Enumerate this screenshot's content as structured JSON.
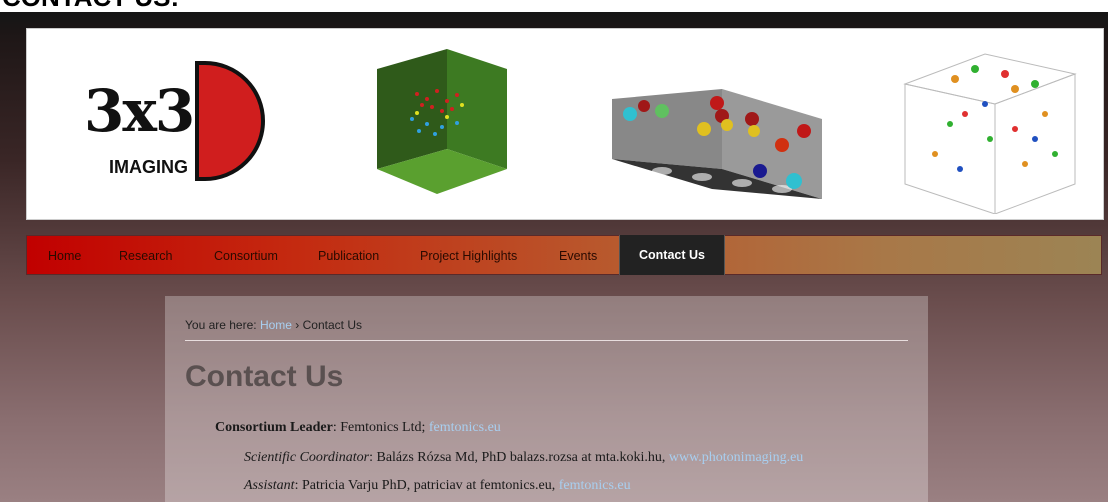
{
  "page": {
    "heading": "CONTACT US:"
  },
  "banner": {
    "logo_text": "3x3",
    "logo_subtext": "IMAGING"
  },
  "nav": {
    "items": [
      {
        "label": "Home"
      },
      {
        "label": "Research"
      },
      {
        "label": "Consortium"
      },
      {
        "label": "Publication"
      },
      {
        "label": "Project Highlights"
      },
      {
        "label": "Events"
      },
      {
        "label": "Contact Us",
        "active": true
      }
    ]
  },
  "breadcrumb": {
    "prefix": "You are here: ",
    "home": "Home",
    "separator": " › ",
    "current": "Contact Us"
  },
  "main": {
    "title": "Contact Us",
    "leader_label": "Consortium Leader",
    "leader_text": ": Femtonics Ltd; ",
    "leader_link": "femtonics.eu",
    "coord_label": "Scientific Coordinator",
    "coord_text": ": Balázs Rózsa Md, PhD balazs.rozsa at mta.koki.hu, ",
    "coord_link": "www.photonimaging.eu",
    "assistant_label": "Assistant",
    "assistant_text": ": Patricia Varju PhD, patriciav at femtonics.eu, ",
    "assistant_link": "femtonics.eu"
  },
  "colors": {
    "nav_start": "#c10000",
    "nav_end": "#9c8454",
    "link": "#a8cff0",
    "logo_red": "#d01e1e"
  }
}
